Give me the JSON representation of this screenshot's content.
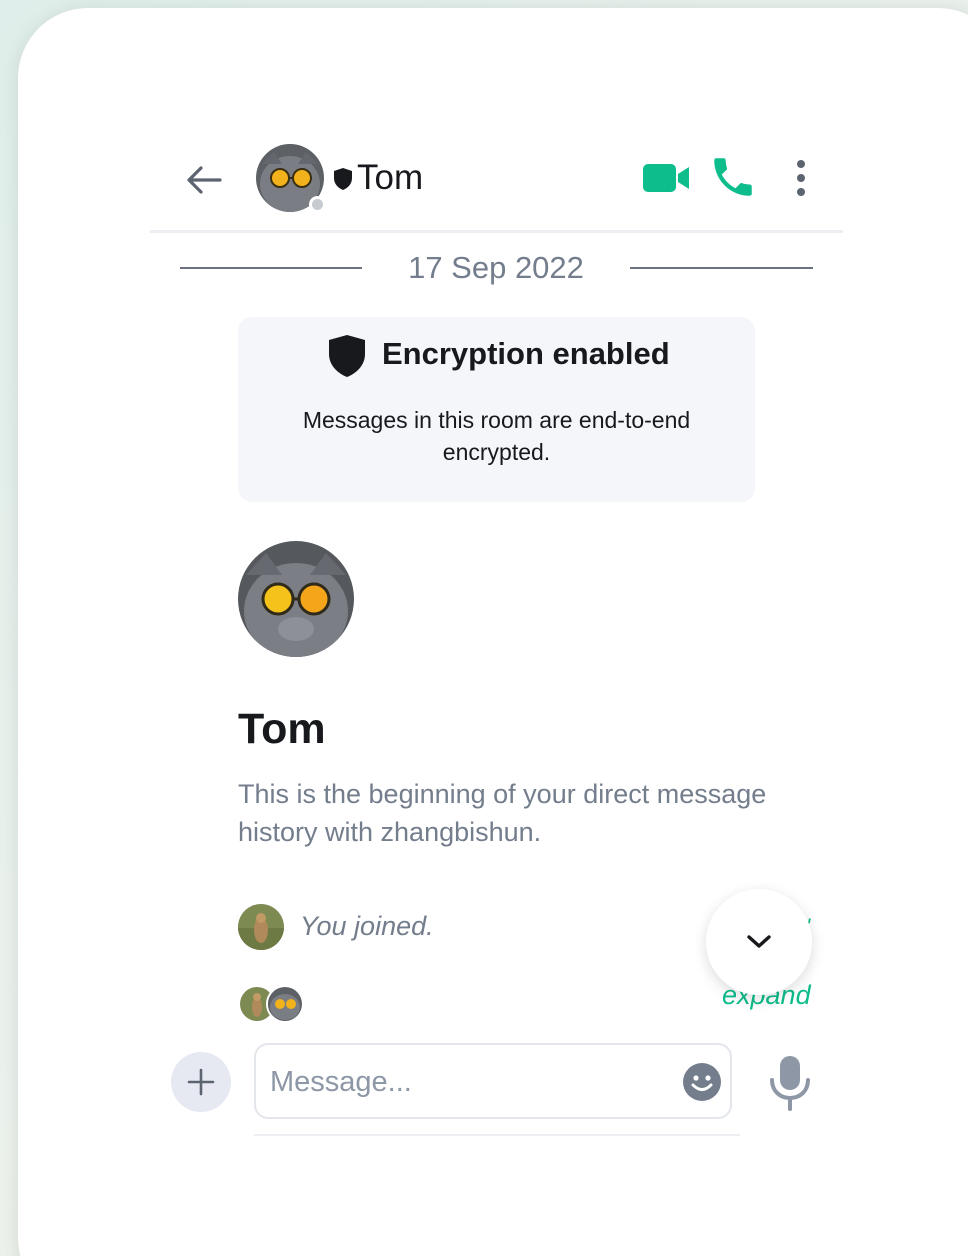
{
  "header": {
    "room_name": "Tom",
    "presence": "offline"
  },
  "timeline": {
    "date_separator": "17 Sep 2022",
    "encryption": {
      "title": "Encryption enabled",
      "description": "Messages in this room are end-to-end encrypted."
    },
    "intro": {
      "name": "Tom",
      "text": "This is the beginning of your direct message history with zhangbishun."
    },
    "events": {
      "joined_text": "You joined.",
      "expand_label": "expand"
    }
  },
  "composer": {
    "placeholder": "Message..."
  },
  "colors": {
    "accent": "#0dbd8b",
    "text_primary": "#17191c",
    "text_secondary": "#737d8c",
    "card_bg": "#f4f6fa"
  },
  "icons": {
    "back": "arrow-left-icon",
    "verified": "shield-icon",
    "video": "video-camera-icon",
    "call": "phone-icon",
    "more": "more-vertical-icon",
    "jump": "chevron-down-icon",
    "add": "plus-icon",
    "emoji": "smiley-icon",
    "mic": "microphone-icon"
  }
}
